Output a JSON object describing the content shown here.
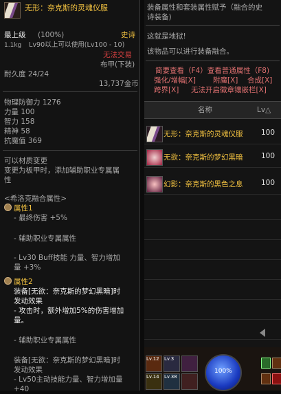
{
  "item": {
    "name": "无形：奈克斯的灵魂仪服",
    "grade": "最上级",
    "grade_pct": "(100%)",
    "rarity": "史诗",
    "weight": "1.1kg",
    "level_req": "Lv90以上可以使用(Lv100 - 10)",
    "trade": "无法交易",
    "armor_type": "布甲(下装)",
    "durability": "耐久度 24/24",
    "price": "13,737金币",
    "stats": [
      {
        "label": "物理防御力",
        "value": "1276"
      },
      {
        "label": "力量",
        "value": "100"
      },
      {
        "label": "智力",
        "value": "158"
      },
      {
        "label": "精神",
        "value": "58"
      },
      {
        "label": "抗魔值",
        "value": "369"
      }
    ],
    "transmute": "可以材质变更",
    "transmute_desc_1": "变更为板甲时，添加辅助职业专属属",
    "transmute_desc_2": "性",
    "fusion_title": "<希洛克融合属性>",
    "attr1_title": "属性1",
    "attr1_l1": "- 最终伤害 +5%",
    "attr1_l2": "- 辅助职业专属属性",
    "attr1_l3": "- Lv30 Buff技能 力量、智力增加",
    "attr1_l4": "量 +3%",
    "attr2_title": "属性2",
    "attr2_l1": "装备[无欲：奈克斯的梦幻黑暗]时",
    "attr2_l2": "发动效果",
    "attr2_l3": "- 攻击时，额外增加5%的伤害增加",
    "attr2_l4": "量。",
    "attr2_l5": "- 辅助职业专属属性",
    "attr2_l6": "装备[无欲：奈克斯的梦幻黑暗]时",
    "attr2_l7": "发动效果",
    "attr2_l8": "- Lv50主动技能力量、智力增加量",
    "attr2_l9": "+40"
  },
  "right_panel": {
    "header_l1": "装备属性和套装属性赋予（融合的史",
    "header_l2": "诗装备)",
    "hell_text": "这就是地狱!",
    "fusion_note": "该物品可以进行装备融合。",
    "hk_1": "简要查看（F4）查看普通属性（F8)",
    "hk_2a": "强化/增幅[X]",
    "hk_2b": "附魔[X]",
    "hk_2c": "合成[X]",
    "hk_3a": "跨界[X]",
    "hk_3b": "无法开启徽章镶嵌栏[X]",
    "col_name": "名称",
    "col_lv": "Lv△",
    "rows": [
      {
        "name": "无形：奈克斯的灵魂仪服",
        "lv": "100"
      },
      {
        "name": "无欲：奈克斯的梦幻黑暗",
        "lv": "100"
      },
      {
        "name": "幻影：奈克斯的黑色之息",
        "lv": "100"
      }
    ]
  },
  "hud": {
    "mp": "100%",
    "slots": [
      {
        "level": "Lv.12"
      },
      {
        "level": "Lv.3"
      },
      {
        "level": "Lv.14"
      },
      {
        "level": "Lv.38"
      }
    ]
  }
}
